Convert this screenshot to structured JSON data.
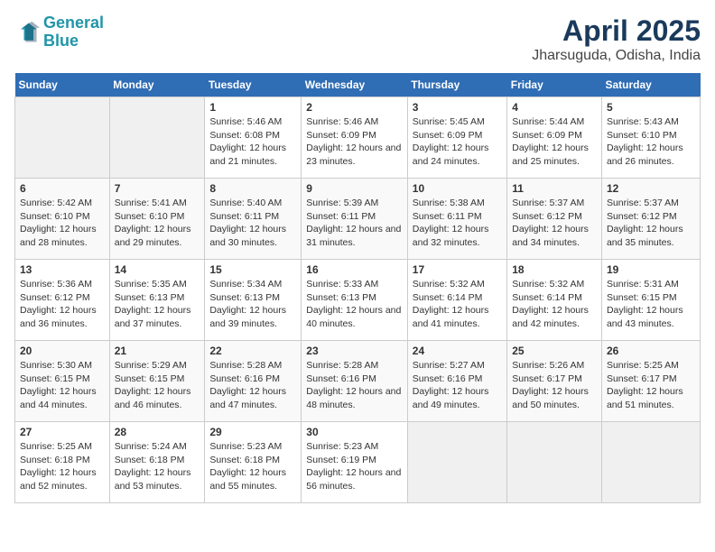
{
  "header": {
    "logo_line1": "General",
    "logo_line2": "Blue",
    "title": "April 2025",
    "subtitle": "Jharsuguda, Odisha, India"
  },
  "days_of_week": [
    "Sunday",
    "Monday",
    "Tuesday",
    "Wednesday",
    "Thursday",
    "Friday",
    "Saturday"
  ],
  "weeks": [
    [
      {
        "day": null
      },
      {
        "day": null
      },
      {
        "day": 1,
        "sunrise": "5:46 AM",
        "sunset": "6:08 PM",
        "daylight": "12 hours and 21 minutes."
      },
      {
        "day": 2,
        "sunrise": "5:46 AM",
        "sunset": "6:09 PM",
        "daylight": "12 hours and 23 minutes."
      },
      {
        "day": 3,
        "sunrise": "5:45 AM",
        "sunset": "6:09 PM",
        "daylight": "12 hours and 24 minutes."
      },
      {
        "day": 4,
        "sunrise": "5:44 AM",
        "sunset": "6:09 PM",
        "daylight": "12 hours and 25 minutes."
      },
      {
        "day": 5,
        "sunrise": "5:43 AM",
        "sunset": "6:10 PM",
        "daylight": "12 hours and 26 minutes."
      }
    ],
    [
      {
        "day": 6,
        "sunrise": "5:42 AM",
        "sunset": "6:10 PM",
        "daylight": "12 hours and 28 minutes."
      },
      {
        "day": 7,
        "sunrise": "5:41 AM",
        "sunset": "6:10 PM",
        "daylight": "12 hours and 29 minutes."
      },
      {
        "day": 8,
        "sunrise": "5:40 AM",
        "sunset": "6:11 PM",
        "daylight": "12 hours and 30 minutes."
      },
      {
        "day": 9,
        "sunrise": "5:39 AM",
        "sunset": "6:11 PM",
        "daylight": "12 hours and 31 minutes."
      },
      {
        "day": 10,
        "sunrise": "5:38 AM",
        "sunset": "6:11 PM",
        "daylight": "12 hours and 32 minutes."
      },
      {
        "day": 11,
        "sunrise": "5:37 AM",
        "sunset": "6:12 PM",
        "daylight": "12 hours and 34 minutes."
      },
      {
        "day": 12,
        "sunrise": "5:37 AM",
        "sunset": "6:12 PM",
        "daylight": "12 hours and 35 minutes."
      }
    ],
    [
      {
        "day": 13,
        "sunrise": "5:36 AM",
        "sunset": "6:12 PM",
        "daylight": "12 hours and 36 minutes."
      },
      {
        "day": 14,
        "sunrise": "5:35 AM",
        "sunset": "6:13 PM",
        "daylight": "12 hours and 37 minutes."
      },
      {
        "day": 15,
        "sunrise": "5:34 AM",
        "sunset": "6:13 PM",
        "daylight": "12 hours and 39 minutes."
      },
      {
        "day": 16,
        "sunrise": "5:33 AM",
        "sunset": "6:13 PM",
        "daylight": "12 hours and 40 minutes."
      },
      {
        "day": 17,
        "sunrise": "5:32 AM",
        "sunset": "6:14 PM",
        "daylight": "12 hours and 41 minutes."
      },
      {
        "day": 18,
        "sunrise": "5:32 AM",
        "sunset": "6:14 PM",
        "daylight": "12 hours and 42 minutes."
      },
      {
        "day": 19,
        "sunrise": "5:31 AM",
        "sunset": "6:15 PM",
        "daylight": "12 hours and 43 minutes."
      }
    ],
    [
      {
        "day": 20,
        "sunrise": "5:30 AM",
        "sunset": "6:15 PM",
        "daylight": "12 hours and 44 minutes."
      },
      {
        "day": 21,
        "sunrise": "5:29 AM",
        "sunset": "6:15 PM",
        "daylight": "12 hours and 46 minutes."
      },
      {
        "day": 22,
        "sunrise": "5:28 AM",
        "sunset": "6:16 PM",
        "daylight": "12 hours and 47 minutes."
      },
      {
        "day": 23,
        "sunrise": "5:28 AM",
        "sunset": "6:16 PM",
        "daylight": "12 hours and 48 minutes."
      },
      {
        "day": 24,
        "sunrise": "5:27 AM",
        "sunset": "6:16 PM",
        "daylight": "12 hours and 49 minutes."
      },
      {
        "day": 25,
        "sunrise": "5:26 AM",
        "sunset": "6:17 PM",
        "daylight": "12 hours and 50 minutes."
      },
      {
        "day": 26,
        "sunrise": "5:25 AM",
        "sunset": "6:17 PM",
        "daylight": "12 hours and 51 minutes."
      }
    ],
    [
      {
        "day": 27,
        "sunrise": "5:25 AM",
        "sunset": "6:18 PM",
        "daylight": "12 hours and 52 minutes."
      },
      {
        "day": 28,
        "sunrise": "5:24 AM",
        "sunset": "6:18 PM",
        "daylight": "12 hours and 53 minutes."
      },
      {
        "day": 29,
        "sunrise": "5:23 AM",
        "sunset": "6:18 PM",
        "daylight": "12 hours and 55 minutes."
      },
      {
        "day": 30,
        "sunrise": "5:23 AM",
        "sunset": "6:19 PM",
        "daylight": "12 hours and 56 minutes."
      },
      {
        "day": null
      },
      {
        "day": null
      },
      {
        "day": null
      }
    ]
  ]
}
